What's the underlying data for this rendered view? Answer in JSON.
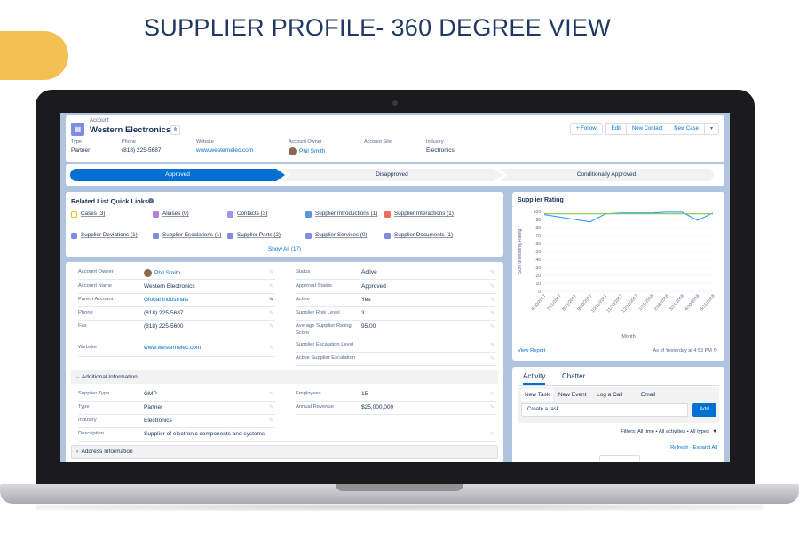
{
  "slide": {
    "headline": "SUPPLIER PROFILE- 360 DEGREE VIEW"
  },
  "colors": {
    "headline": "#1f3864",
    "tab_accent": "#f2c053",
    "brand_blue": "#0070d2",
    "screen_bg": "#b0c4df",
    "chart_line": "#1b96ff",
    "chart_target": "#8bc34a"
  },
  "header": {
    "object_type": "Account",
    "record_name": "Western Electronics",
    "buttons": {
      "follow": "+ Follow",
      "edit": "Edit",
      "new_contact": "New Contact",
      "new_case": "New Case",
      "more": "▾"
    },
    "fields": [
      {
        "label": "Type",
        "value": "Partner"
      },
      {
        "label": "Phone",
        "value": "(818) 225-5687"
      },
      {
        "label": "Website",
        "value": "www.westernelec.com"
      },
      {
        "label": "Account Owner",
        "value": "Phil Smith"
      },
      {
        "label": "Account Site",
        "value": ""
      },
      {
        "label": "Industry",
        "value": "Electronics"
      }
    ]
  },
  "path": {
    "step1": "Approved",
    "step2": "Disapproved",
    "step3": "Conditionally Approved"
  },
  "related": {
    "title": "Related List Quick Links",
    "items": [
      {
        "label": "Cases (3)",
        "color": "#f4bc25"
      },
      {
        "label": "Aliases (0)",
        "color": "#b781d3"
      },
      {
        "label": "Contacts (3)",
        "color": "#a094ed"
      },
      {
        "label": "Supplier Introductions (1)",
        "color": "#5a95dd"
      },
      {
        "label": "Supplier Interactions (1)",
        "color": "#ef6e64"
      },
      {
        "label": "Supplier Deviations (1)",
        "color": "#7f8de1"
      },
      {
        "label": "Supplier Escalations (1)",
        "color": "#7f8de1"
      },
      {
        "label": "Supplier Parts (2)",
        "color": "#7f8de1"
      },
      {
        "label": "Supplier Services (0)",
        "color": "#7f8de1"
      },
      {
        "label": "Supplier Documents (1)",
        "color": "#7f8de1"
      }
    ],
    "show_all": "Show All (17)"
  },
  "details": {
    "left": [
      {
        "label": "Account Owner",
        "value": "Phil Smith"
      },
      {
        "label": "Account Name",
        "value": "Western Electronics"
      },
      {
        "label": "Parent Account",
        "value": "Global Industrials"
      },
      {
        "label": "Phone",
        "value": "(818) 225-5687"
      },
      {
        "label": "Fax",
        "value": "(818) 225-5600"
      },
      {
        "label": "Website",
        "value": "www.westernelec.com"
      }
    ],
    "right": [
      {
        "label": "Status",
        "value": "Active"
      },
      {
        "label": "Approval Status",
        "value": "Approved"
      },
      {
        "label": "Active",
        "value": "Yes"
      },
      {
        "label": "Supplier Risk Level",
        "value": "3"
      },
      {
        "label": "Average Supplier Rating Score",
        "value": "95.00"
      },
      {
        "label": "Supplier Escalation Level",
        "value": ""
      },
      {
        "label": "Active Supplier Escalation",
        "value": ""
      }
    ],
    "additional_header": "Additional Information",
    "additional_left": [
      {
        "label": "Supplier Type",
        "value": "GMP"
      },
      {
        "label": "Type",
        "value": "Partner"
      },
      {
        "label": "Industry",
        "value": "Electronics"
      },
      {
        "label": "Description",
        "value": "Supplier of electronic components and systems"
      }
    ],
    "additional_right": [
      {
        "label": "Employees",
        "value": "15"
      },
      {
        "label": "Annual Revenue",
        "value": "$25,000,000"
      }
    ],
    "address_header": "Address Information"
  },
  "rating_card": {
    "view_report": "View Report",
    "as_of": "As of Yesterday at 4:53 PM"
  },
  "chart_data": {
    "type": "line",
    "title": "Supplier Rating",
    "xlabel": "Month",
    "ylabel": "Sum of Monthly Rating",
    "ylim": [
      0,
      100
    ],
    "yticks": [
      0,
      10,
      20,
      30,
      40,
      50,
      60,
      70,
      80,
      90,
      100
    ],
    "x": [
      "6/30/2017",
      "7/31/2017",
      "8/31/2017",
      "9/30/2017",
      "10/31/2017",
      "11/30/2017",
      "12/31/2017",
      "1/31/2018",
      "2/28/2018",
      "3/31/2018",
      "4/30/2018",
      "5/31/2018"
    ],
    "series": [
      {
        "values": [
          96,
          93,
          90,
          87,
          97,
          98,
          98,
          98,
          99,
          99,
          89,
          98
        ]
      },
      {
        "values": [
          97,
          97,
          97,
          97,
          97,
          97,
          97,
          97,
          97,
          97,
          97,
          97
        ]
      }
    ],
    "grid": true
  },
  "activity": {
    "tabs": [
      "Activity",
      "Chatter"
    ],
    "subtabs": [
      "New Task",
      "New Event",
      "Log a Call",
      "Email"
    ],
    "task_placeholder": "Create a task...",
    "add_button": "Add",
    "filters": "Filters: All time • All activities • All types",
    "refresh": "Refresh",
    "expand_all": "Expand All"
  }
}
